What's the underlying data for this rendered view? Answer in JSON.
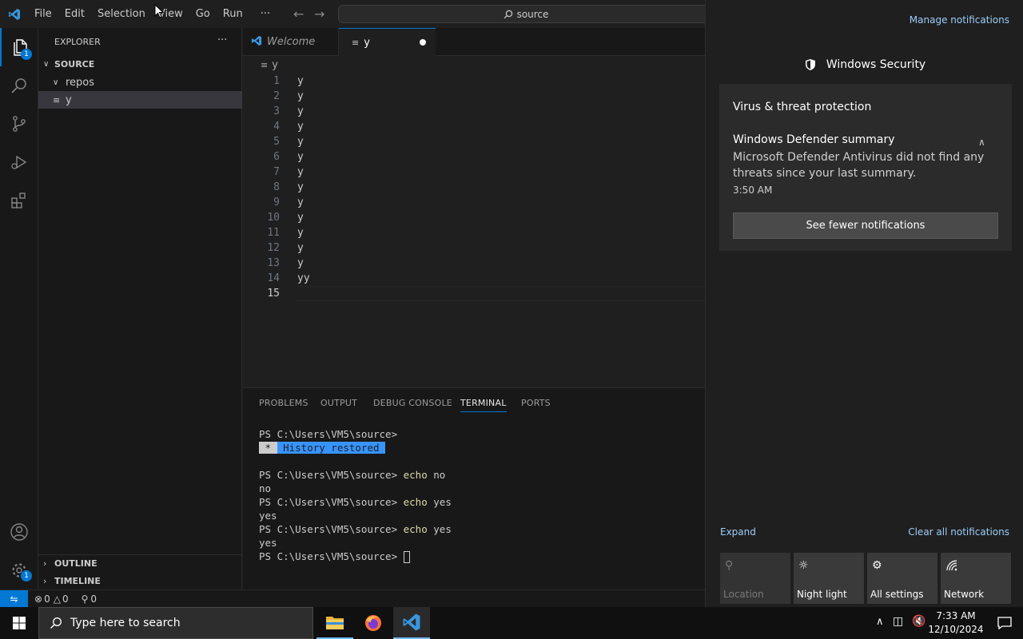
{
  "titlebar": {
    "menu": [
      "File",
      "Edit",
      "Selection",
      "View",
      "Go",
      "Run",
      "···"
    ],
    "command_center": "source"
  },
  "activity": {
    "explorer_badge": "1",
    "settings_badge": "1"
  },
  "sidebar": {
    "title": "EXPLORER",
    "more": "···",
    "root": "SOURCE",
    "folder": "repos",
    "file": "y",
    "outline": "OUTLINE",
    "timeline": "TIMELINE"
  },
  "tabs": {
    "welcome": "Welcome",
    "active": "y"
  },
  "editor": {
    "breadcrumb": "y",
    "lines": [
      {
        "n": "1",
        "t": "y"
      },
      {
        "n": "2",
        "t": "y"
      },
      {
        "n": "3",
        "t": "y"
      },
      {
        "n": "4",
        "t": "y"
      },
      {
        "n": "5",
        "t": "y"
      },
      {
        "n": "6",
        "t": "y"
      },
      {
        "n": "7",
        "t": "y"
      },
      {
        "n": "8",
        "t": "y"
      },
      {
        "n": "9",
        "t": "y"
      },
      {
        "n": "10",
        "t": "y"
      },
      {
        "n": "11",
        "t": "y"
      },
      {
        "n": "12",
        "t": "y"
      },
      {
        "n": "13",
        "t": "y"
      },
      {
        "n": "14",
        "t": "yy"
      },
      {
        "n": "15",
        "t": ""
      }
    ]
  },
  "panel": {
    "tabs": [
      "PROBLEMS",
      "OUTPUT",
      "DEBUG CONSOLE",
      "TERMINAL",
      "PORTS"
    ],
    "active_tab": "TERMINAL",
    "prompt": "PS C:\\Users\\VM5\\source>",
    "history_star": " * ",
    "history_text": " History restored ",
    "cmd1": "echo",
    "arg1": "no",
    "out1": "no",
    "cmd2": "echo",
    "arg2": "yes",
    "out2": "yes",
    "cmd3": "echo",
    "arg3": "yes",
    "out3": "yes"
  },
  "statusbar": {
    "errors": "0",
    "warnings": "0",
    "ports": "0"
  },
  "notifications": {
    "manage": "Manage notifications",
    "app": "Windows Security",
    "group": "Virus & threat protection",
    "title": "Windows Defender summary",
    "body": "Microsoft Defender Antivirus did not find any threats since your last summary.",
    "time": "3:50 AM",
    "fewer": "See fewer notifications",
    "expand": "Expand",
    "clear": "Clear all notifications",
    "quick_actions": [
      {
        "label": "Location",
        "icon": "location-icon",
        "disabled": true
      },
      {
        "label": "Night light",
        "icon": "night-light-icon",
        "disabled": false
      },
      {
        "label": "All settings",
        "icon": "settings-icon",
        "disabled": false
      },
      {
        "label": "Network",
        "icon": "network-icon",
        "disabled": false
      }
    ]
  },
  "taskbar": {
    "search_placeholder": "Type here to search",
    "time": "7:33 AM",
    "date": "12/10/2024"
  },
  "colors": {
    "accent": "#0078d4",
    "terminal_cmd": "#dcdcaa",
    "history_bg": "#3794ff"
  }
}
